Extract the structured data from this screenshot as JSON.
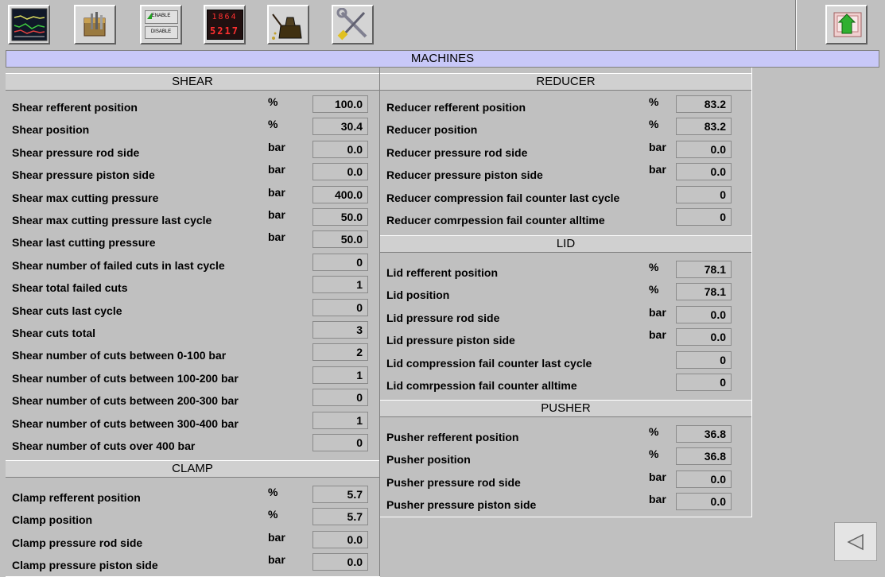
{
  "title": "MACHINES",
  "toolbar": {
    "enable_label": "ENABLE",
    "disable_label": "DISABLE",
    "counter_top": "1864",
    "counter_bottom": "5217"
  },
  "shear": {
    "header": "SHEAR",
    "rows": [
      {
        "label": "Shear refferent position",
        "unit": "%",
        "value": "100.0"
      },
      {
        "label": "Shear position",
        "unit": "%",
        "value": "30.4"
      },
      {
        "label": "Shear pressure rod side",
        "unit": "bar",
        "value": "0.0"
      },
      {
        "label": "Shear pressure piston side",
        "unit": "bar",
        "value": "0.0"
      },
      {
        "label": "Shear max cutting pressure",
        "unit": "bar",
        "value": "400.0"
      },
      {
        "label": "Shear max cutting pressure last cycle",
        "unit": "bar",
        "value": "50.0"
      },
      {
        "label": "Shear last cutting pressure",
        "unit": "bar",
        "value": "50.0"
      },
      {
        "label": "Shear number of failed cuts in last cycle",
        "unit": "",
        "value": "0"
      },
      {
        "label": "Shear total failed cuts",
        "unit": "",
        "value": "1"
      },
      {
        "label": "Shear cuts last cycle",
        "unit": "",
        "value": "0"
      },
      {
        "label": "Shear cuts total",
        "unit": "",
        "value": "3"
      },
      {
        "label": "Shear number of cuts between 0-100 bar",
        "unit": "",
        "value": "2"
      },
      {
        "label": "Shear number of cuts between 100-200 bar",
        "unit": "",
        "value": "1"
      },
      {
        "label": "Shear number of cuts between 200-300 bar",
        "unit": "",
        "value": "0"
      },
      {
        "label": "Shear number of cuts between 300-400 bar",
        "unit": "",
        "value": "1"
      },
      {
        "label": "Shear number of cuts over 400 bar",
        "unit": "",
        "value": "0"
      }
    ]
  },
  "clamp": {
    "header": "CLAMP",
    "rows": [
      {
        "label": "Clamp refferent position",
        "unit": "%",
        "value": "5.7"
      },
      {
        "label": "Clamp position",
        "unit": "%",
        "value": "5.7"
      },
      {
        "label": "Clamp pressure rod side",
        "unit": "bar",
        "value": "0.0"
      },
      {
        "label": "Clamp pressure piston side",
        "unit": "bar",
        "value": "0.0"
      }
    ]
  },
  "reducer": {
    "header": "REDUCER",
    "rows": [
      {
        "label": "Reducer refferent position",
        "unit": "%",
        "value": "83.2"
      },
      {
        "label": "Reducer position",
        "unit": "%",
        "value": "83.2"
      },
      {
        "label": "Reducer pressure rod side",
        "unit": "bar",
        "value": "0.0"
      },
      {
        "label": "Reducer pressure piston side",
        "unit": "bar",
        "value": "0.0"
      },
      {
        "label": "Reducer compression fail counter last cycle",
        "unit": "",
        "value": "0"
      },
      {
        "label": "Reducer comrpession fail counter alltime",
        "unit": "",
        "value": "0"
      }
    ]
  },
  "lid": {
    "header": "LID",
    "rows": [
      {
        "label": "Lid refferent position",
        "unit": "%",
        "value": "78.1"
      },
      {
        "label": "Lid position",
        "unit": "%",
        "value": "78.1"
      },
      {
        "label": "Lid pressure rod side",
        "unit": "bar",
        "value": "0.0"
      },
      {
        "label": "Lid pressure piston side",
        "unit": "bar",
        "value": "0.0"
      },
      {
        "label": "Lid compression fail counter last cycle",
        "unit": "",
        "value": "0"
      },
      {
        "label": "Lid comrpession fail counter alltime",
        "unit": "",
        "value": "0"
      }
    ]
  },
  "pusher": {
    "header": "PUSHER",
    "rows": [
      {
        "label": "Pusher refferent position",
        "unit": "%",
        "value": "36.8"
      },
      {
        "label": "Pusher position",
        "unit": "%",
        "value": "36.8"
      },
      {
        "label": "Pusher pressure rod side",
        "unit": "bar",
        "value": "0.0"
      },
      {
        "label": "Pusher pressure piston side",
        "unit": "bar",
        "value": "0.0"
      }
    ]
  },
  "colors": {
    "background": "#c0c0c0",
    "title_bar": "#c8c8f8",
    "counter_digits": "#ff3030"
  },
  "icons": [
    "trend-chart-icon",
    "toolbox-icon",
    "enable-disable-icon",
    "counter-display-icon",
    "oil-can-icon",
    "tools-icon",
    "exit-icon",
    "back-arrow-icon"
  ]
}
